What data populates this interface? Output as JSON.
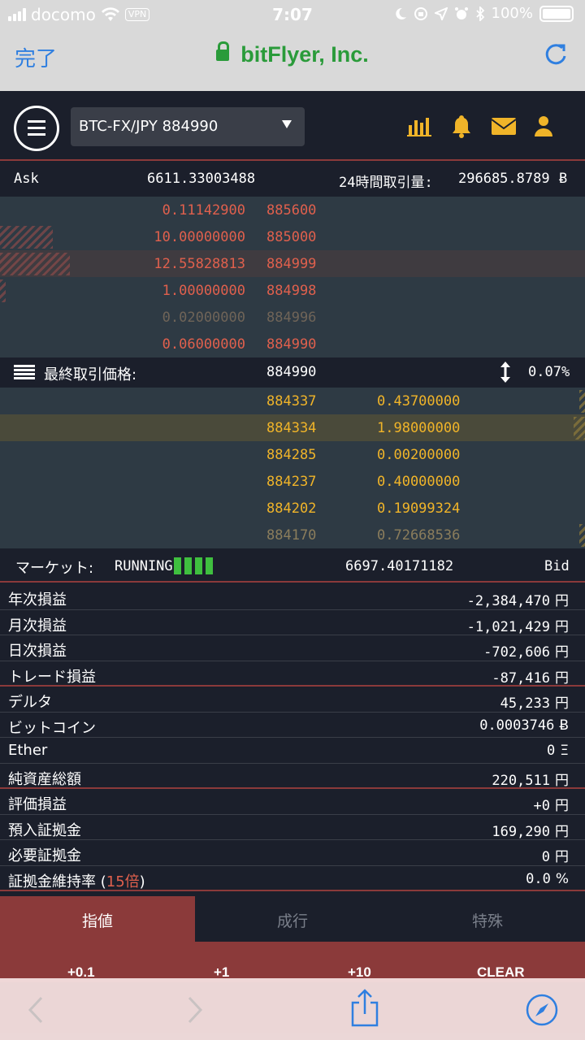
{
  "status_bar": {
    "carrier": "docomo",
    "vpn": "VPN",
    "time": "7:07",
    "battery": "100%"
  },
  "browser": {
    "done_label": "完了",
    "title": "bitFlyer, Inc.",
    "icons": [
      "lock-icon",
      "reload-icon",
      "back-icon",
      "forward-icon",
      "share-icon",
      "compass-icon"
    ]
  },
  "header": {
    "pair": "BTC-FX/JPY 884990",
    "icons": [
      "chart-icon",
      "bell-icon",
      "mail-icon",
      "user-icon"
    ]
  },
  "ask": {
    "label": "Ask",
    "total": "6611.33003488",
    "volume_label": "24時間取引量:",
    "volume": "296685.8789",
    "btc_sign": "Ƀ"
  },
  "asks": [
    {
      "qty": "0.11142900",
      "price": "885600",
      "depth": 0.0
    },
    {
      "qty": "10.00000000",
      "price": "885000",
      "depth": 0.09
    },
    {
      "qty": "12.55828813",
      "price": "884999",
      "depth": 0.12
    },
    {
      "qty": "1.00000000",
      "price": "884998",
      "depth": 0.01
    },
    {
      "qty": "0.02000000",
      "price": "884996",
      "depth": 0.0
    },
    {
      "qty": "0.06000000",
      "price": "884990",
      "depth": 0.0
    }
  ],
  "last": {
    "label": "最終取引価格:",
    "price": "884990",
    "change": "0.07%"
  },
  "bids": [
    {
      "price": "884337",
      "qty": "0.43700000",
      "depth": 0.01
    },
    {
      "price": "884334",
      "qty": "1.98000000",
      "depth": 0.02
    },
    {
      "price": "884285",
      "qty": "0.00200000",
      "depth": 0.0
    },
    {
      "price": "884237",
      "qty": "0.40000000",
      "depth": 0.0
    },
    {
      "price": "884202",
      "qty": "0.19099324",
      "depth": 0.0
    },
    {
      "price": "884170",
      "qty": "0.72668536",
      "depth": 0.01
    }
  ],
  "market": {
    "label": "マーケット:",
    "status": "RUNNING",
    "bid_total": "6697.40171182",
    "bid_label": "Bid"
  },
  "stats": [
    {
      "label": "年次損益",
      "value": "-2,384,470",
      "unit": "円"
    },
    {
      "label": "月次損益",
      "value": "-1,021,429",
      "unit": "円"
    },
    {
      "label": "日次損益",
      "value": "-702,606",
      "unit": "円"
    },
    {
      "label": "トレード損益",
      "value": "-87,416",
      "unit": "円"
    },
    {
      "label": "デルタ",
      "value": "45,233",
      "unit": "円"
    },
    {
      "label": "ビットコイン",
      "value": "0.0003746",
      "unit": "Ƀ"
    },
    {
      "label": "Ether",
      "value": "0",
      "unit": "Ξ"
    },
    {
      "label": "純資産総額",
      "value": "220,511",
      "unit": "円"
    },
    {
      "label": "評価損益",
      "value": "+0",
      "unit": "円"
    },
    {
      "label": "預入証拠金",
      "value": "169,290",
      "unit": "円"
    },
    {
      "label": "必要証拠金",
      "value": "0",
      "unit": "円"
    },
    {
      "label": "証拠金維持率",
      "value": "0.0",
      "unit": "%"
    }
  ],
  "leverage": {
    "open": " (",
    "value": "15倍",
    "close": ")"
  },
  "order_tabs": [
    "指値",
    "成行",
    "特殊"
  ],
  "quick_buttons": [
    "+0.1",
    "+1",
    "+10",
    "CLEAR"
  ]
}
